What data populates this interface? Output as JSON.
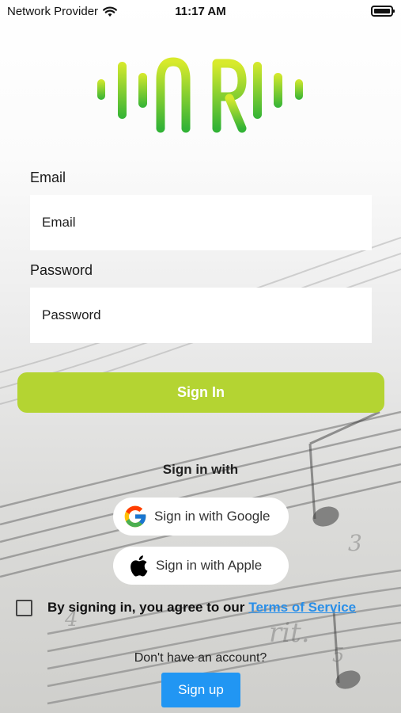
{
  "status_bar": {
    "carrier": "Network Provider",
    "time": "11:17 AM",
    "wifi_icon": "wifi-icon",
    "battery_icon": "battery-icon"
  },
  "logo": {
    "text": "AiR",
    "gradient_top": "#d8ea2c",
    "gradient_bottom": "#33b336"
  },
  "form": {
    "email_label": "Email",
    "email_placeholder": "Email",
    "email_value": "",
    "password_label": "Password",
    "password_placeholder": "Password",
    "password_value": ""
  },
  "sign_in_button": {
    "label": "Sign In",
    "color": "#b4d432"
  },
  "social": {
    "heading": "Sign in with",
    "google_label": "Sign in with Google",
    "google_icon": "google-icon",
    "apple_label": "Sign in with Apple",
    "apple_icon": "apple-icon"
  },
  "terms": {
    "checked": false,
    "text": "By signing in, you agree to our",
    "link_text": "Terms of Service",
    "link_color": "#2a8fe8"
  },
  "signup": {
    "prompt": "Don't have an account?",
    "button_label": "Sign up",
    "button_color": "#2196f3"
  }
}
